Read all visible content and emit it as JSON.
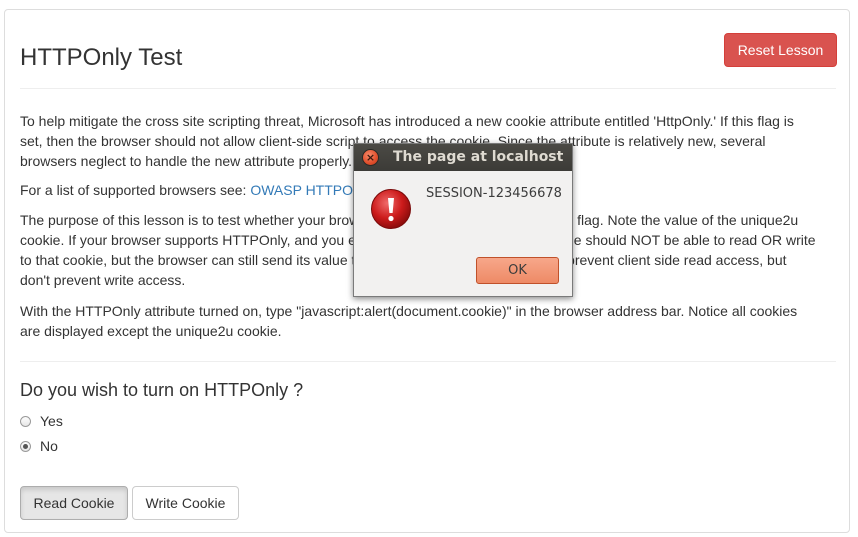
{
  "page": {
    "title": "HTTPOnly Test",
    "reset_label": "Reset Lesson",
    "paragraphs": {
      "p1": [
        "To help mitigate the cross site scripting threat, Microsoft has introduced a new cookie attribute entitled 'HttpOnly.' If this flag is",
        "set, then the browser should not allow client-side script to access the cookie. Since the attribute is relatively new, several",
        "browsers neglect to handle the new attribute properly."
      ],
      "p2_prefix": "For a list of supported browsers see: ",
      "p2_link": "OWASP HTTPOnly Support",
      "p3": [
        "The purpose of this lesson is to test whether your browser supports the HTTPOnly cookie flag. Note the value of the unique2u",
        "cookie. If your browser supports HTTPOnly, and you enable it for a cookie, client side code should NOT be able to read OR write",
        "to that cookie, but the browser can still send its value to the server. Some browsers only prevent client side read access, but",
        "don't prevent write access."
      ],
      "p4": [
        "With the HTTPOnly attribute turned on, type \"javascript:alert(document.cookie)\" in the browser address bar. Notice all cookies",
        "are displayed except the unique2u cookie."
      ]
    },
    "question": "Do you wish to turn on HTTPOnly ?",
    "options": [
      {
        "label": "Yes",
        "checked": false
      },
      {
        "label": "No",
        "checked": true
      }
    ],
    "read_cookie_label": "Read Cookie",
    "write_cookie_label": "Write Cookie"
  },
  "dialog": {
    "title": "The page at localhost",
    "message": "SESSION-123456678",
    "ok_label": "OK",
    "close_glyph": "×",
    "icon": "error-icon"
  },
  "colors": {
    "danger": "#d9534f",
    "link": "#337ab7",
    "titlebar": "#3c3b37",
    "ok_button": "#ee8a66"
  }
}
